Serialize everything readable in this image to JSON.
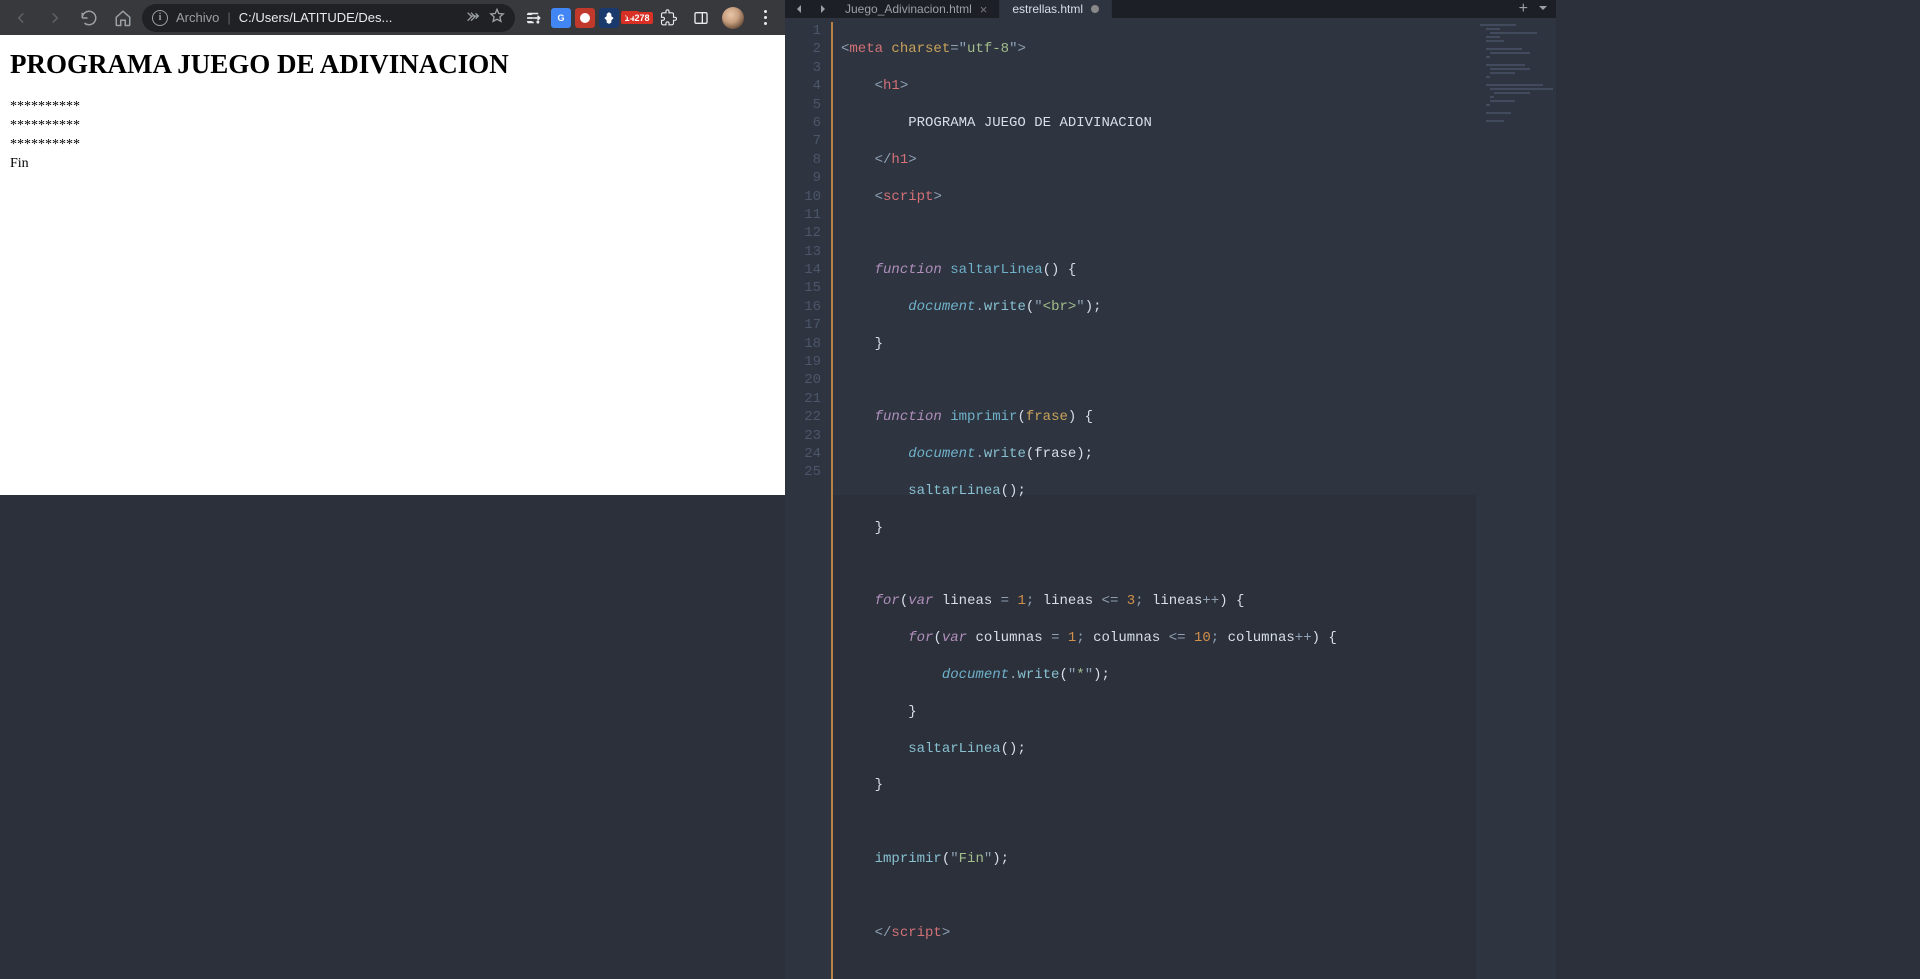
{
  "chrome": {
    "address": {
      "file_label": "Archivo",
      "url": "C:/Users/LATITUDE/Des..."
    },
    "extensions": {
      "translate_label": "G",
      "mail_count": "14278"
    }
  },
  "page": {
    "heading": "PROGRAMA JUEGO DE ADIVINACION",
    "lines": [
      "**********",
      "**********",
      "**********",
      "Fin"
    ]
  },
  "editor": {
    "tabs": [
      {
        "name": "Juego_Adivinacion.html",
        "active": false,
        "dirty": false
      },
      {
        "name": "estrellas.html",
        "active": true,
        "dirty": true
      }
    ],
    "code": {
      "line_start": 1,
      "line_count": 25,
      "l1": {
        "tag_open": "<",
        "tag": "meta",
        "attr": "charset",
        "eq": "=",
        "q": "\"",
        "val": "utf-8",
        "tag_close": ">"
      },
      "l2": {
        "tag_open": "<",
        "tag": "h1",
        "tag_close": ">"
      },
      "l3": {
        "text": "PROGRAMA JUEGO DE ADIVINACION"
      },
      "l4": {
        "tag_open": "</",
        "tag": "h1",
        "tag_close": ">"
      },
      "l5": {
        "tag_open": "<",
        "tag": "script",
        "tag_close": ">"
      },
      "l7": {
        "kw": "function",
        "name": "saltarLinea",
        "paren": "() {"
      },
      "l8": {
        "obj": "document",
        "dot": ".",
        "fn": "write",
        "open": "(",
        "q": "\"",
        "str": "<br>",
        "close": ");"
      },
      "l9": {
        "brace": "}"
      },
      "l11": {
        "kw": "function",
        "name": "imprimir",
        "open": "(",
        "arg": "frase",
        "close": ") {"
      },
      "l12": {
        "obj": "document",
        "dot": ".",
        "fn": "write",
        "open": "(",
        "arg": "frase",
        "close": ");"
      },
      "l13": {
        "fn": "saltarLinea",
        "call": "();"
      },
      "l14": {
        "brace": "}"
      },
      "l16": {
        "kw1": "for",
        "open": "(",
        "kw2": "var",
        "v": "lineas",
        "eq": " = ",
        "n1": "1",
        "sep1": "; ",
        "v2": "lineas",
        "op": " <= ",
        "n2": "3",
        "sep2": "; ",
        "v3": "lineas",
        "inc": "++",
        "close": ") {"
      },
      "l17": {
        "kw1": "for",
        "open": "(",
        "kw2": "var",
        "v": "columnas",
        "eq": " = ",
        "n1": "1",
        "sep1": "; ",
        "v2": "columnas",
        "op": " <= ",
        "n2": "10",
        "sep2": "; ",
        "v3": "columnas",
        "inc": "++",
        "close": ") {"
      },
      "l18": {
        "obj": "document",
        "dot": ".",
        "fn": "write",
        "open": "(",
        "q": "\"",
        "str": "*",
        "close": ");"
      },
      "l19": {
        "brace": "}"
      },
      "l20": {
        "fn": "saltarLinea",
        "call": "();"
      },
      "l21": {
        "brace": "}"
      },
      "l23": {
        "fn": "imprimir",
        "open": "(",
        "q": "\"",
        "str": "Fin",
        "close": ");"
      },
      "l25": {
        "tag_open": "</",
        "tag": "script",
        "tag_close": ">"
      }
    }
  }
}
